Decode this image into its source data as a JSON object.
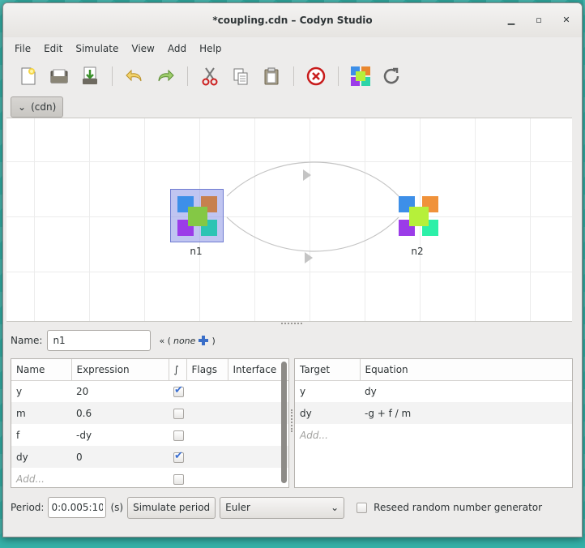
{
  "window": {
    "title": "*coupling.cdn – Codyn Studio"
  },
  "menu": [
    "File",
    "Edit",
    "Simulate",
    "View",
    "Add",
    "Help"
  ],
  "icons": {
    "new": "new-file-icon",
    "open": "open-folder-icon",
    "save": "save-icon",
    "undo": "undo-icon",
    "redo": "redo-icon",
    "cut": "scissors-icon",
    "copy": "copy-icon",
    "paste": "paste-icon",
    "delete": "delete-icon",
    "group": "group-node-icon",
    "refresh": "refresh-icon"
  },
  "breadcrumb": {
    "label": "(cdn)"
  },
  "canvas": {
    "nodes": [
      {
        "id": "n1",
        "label": "n1",
        "selected": true
      },
      {
        "id": "n2",
        "label": "n2",
        "selected": false
      }
    ]
  },
  "properties": {
    "name_label": "Name:",
    "name_value": "n1",
    "template_prefix": "« (",
    "template_none": "none",
    "template_suffix": ")"
  },
  "variables": {
    "headers": [
      "Name",
      "Expression",
      "∫",
      "Flags",
      "Interface"
    ],
    "rows": [
      {
        "name": "y",
        "expression": "20",
        "integrated": true
      },
      {
        "name": "m",
        "expression": "0.6",
        "integrated": false
      },
      {
        "name": "f",
        "expression": "-dy",
        "integrated": false
      },
      {
        "name": "dy",
        "expression": "0",
        "integrated": true
      }
    ],
    "add_placeholder": "Add..."
  },
  "edges": {
    "headers": [
      "Target",
      "Equation"
    ],
    "rows": [
      {
        "target": "y",
        "equation": "dy"
      },
      {
        "target": "dy",
        "equation": "-g + f / m"
      }
    ],
    "add_placeholder": "Add..."
  },
  "simulation": {
    "period_label": "Period:",
    "period_value": "0:0.005:10",
    "unit": "(s)",
    "simulate_button": "Simulate period",
    "integrator": "Euler",
    "reseed_label": "Reseed random number generator",
    "reseed_checked": false
  },
  "colors": {
    "desktop": "#34b1a8",
    "selection": "#8c96e6",
    "check": "#3b6fd1"
  }
}
